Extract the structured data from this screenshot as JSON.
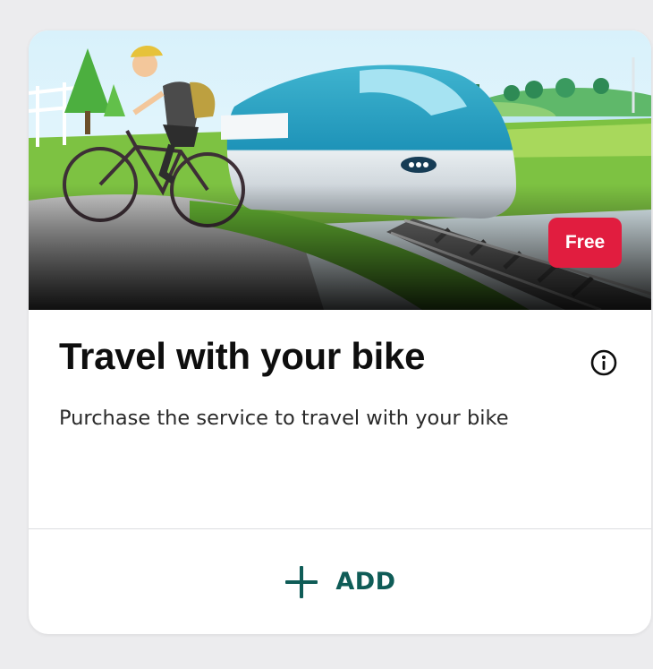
{
  "product": {
    "title": "Travel with your bike",
    "description": "Purchase the service to travel with your bike",
    "badge": "Free",
    "add_label": "ADD",
    "info_icon": "info-circle-icon",
    "add_icon": "plus-icon"
  },
  "colors": {
    "badge_bg": "#e11d3f",
    "accent": "#0f5c57",
    "title": "#0e0e0e"
  }
}
